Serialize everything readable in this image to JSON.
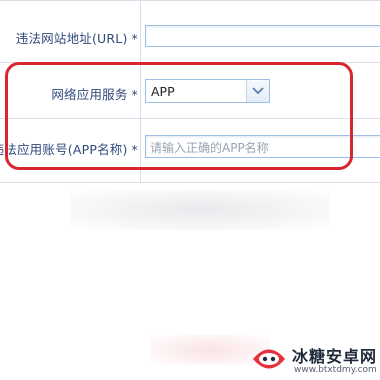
{
  "form": {
    "url_field": {
      "label": "违法网站地址(URL)",
      "required_mark": "*",
      "value": ""
    },
    "service_field": {
      "label": "网络应用服务",
      "required_mark": "*",
      "selected": "APP"
    },
    "app_name_field": {
      "label": "违法应用账号(APP名称)",
      "required_mark": "*",
      "placeholder": "请输入正确的APP名称"
    }
  },
  "watermark": {
    "title": "冰糖安卓网",
    "url": "www.btxtdmy.com"
  },
  "colors": {
    "highlight": "#d8262e",
    "label_text": "#2f4a7a",
    "input_border": "#9fc0e6"
  },
  "icons": {
    "select_arrow": "chevron-down-icon"
  }
}
